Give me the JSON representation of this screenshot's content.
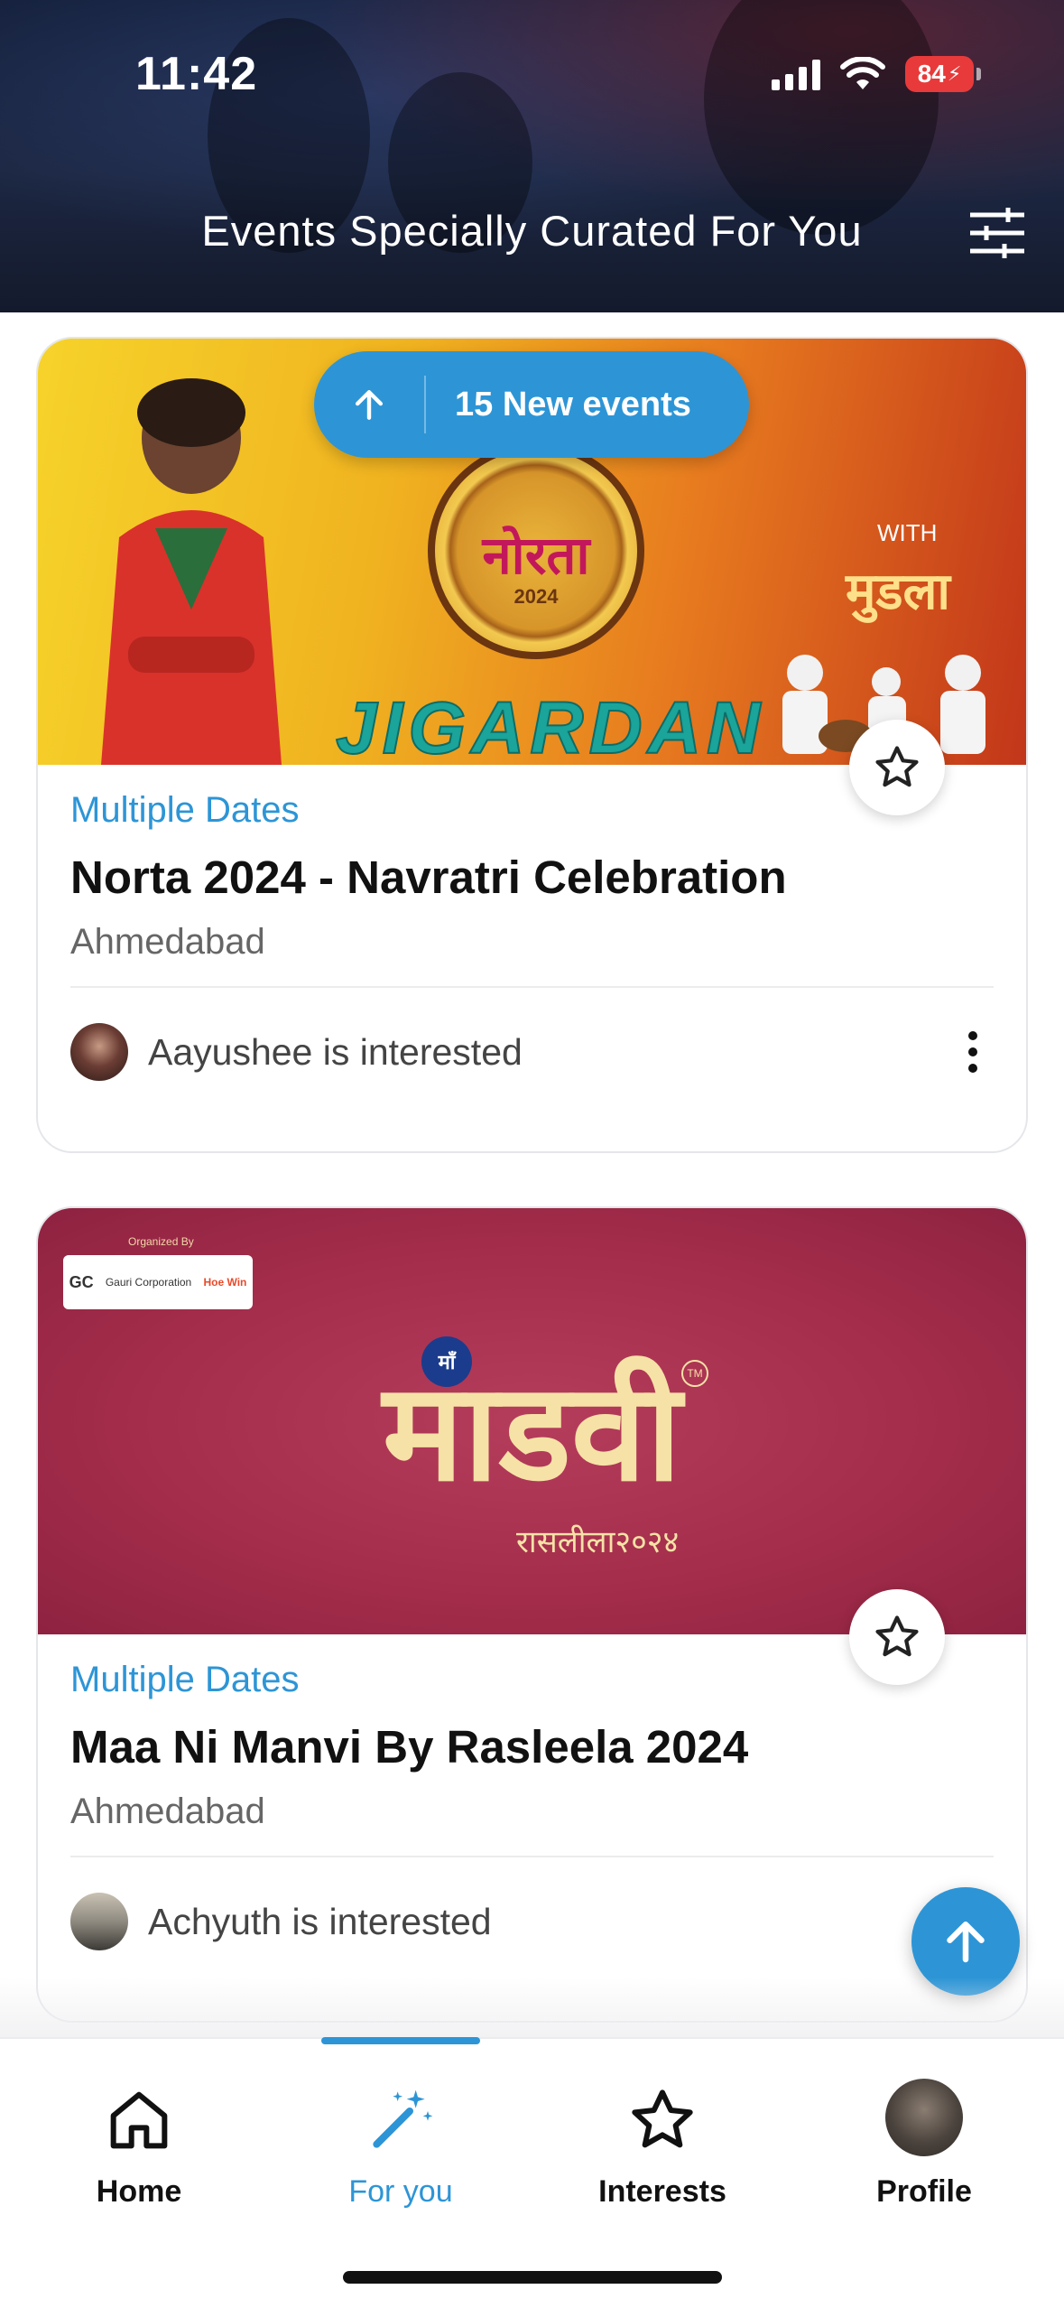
{
  "status_bar": {
    "time": "11:42",
    "battery": "84"
  },
  "header": {
    "title": "Events Specially Curated For You",
    "filter_icon": "sliders-icon"
  },
  "new_events_pill": {
    "label": "15 New events",
    "icon": "arrow-up-icon"
  },
  "events": [
    {
      "dates": "Multiple Dates",
      "title": "Norta 2024 - Navratri Celebration",
      "city": "Ahmedabad",
      "interested": "Aayushee is interested",
      "banner": {
        "badge_text": "नोरता",
        "badge_year": "2024",
        "artist": "JIGARDAN",
        "with": "WITH",
        "mudla": "मुडला"
      }
    },
    {
      "dates": "Multiple Dates",
      "title": "Maa Ni Manvi By Rasleela 2024",
      "city": "Ahmedabad",
      "interested": "Achyuth is interested",
      "banner": {
        "organized_by": "Organized By",
        "sponsor_1": "GC",
        "sponsor_2": "Gauri Corporation",
        "sponsor_3": "Hoe Win",
        "emblem": "माँ",
        "logo_text": "माडवी",
        "tm": "TM",
        "subtitle": "रासलीला२०२४"
      }
    }
  ],
  "tabs": [
    {
      "label": "Home",
      "icon": "home-icon"
    },
    {
      "label": "For you",
      "icon": "magic-wand-icon",
      "active": true
    },
    {
      "label": "Interests",
      "icon": "star-icon"
    },
    {
      "label": "Profile",
      "icon": "profile-avatar"
    }
  ],
  "colors": {
    "accent": "#2d95d6",
    "text": "#111111",
    "muted": "#666666"
  }
}
